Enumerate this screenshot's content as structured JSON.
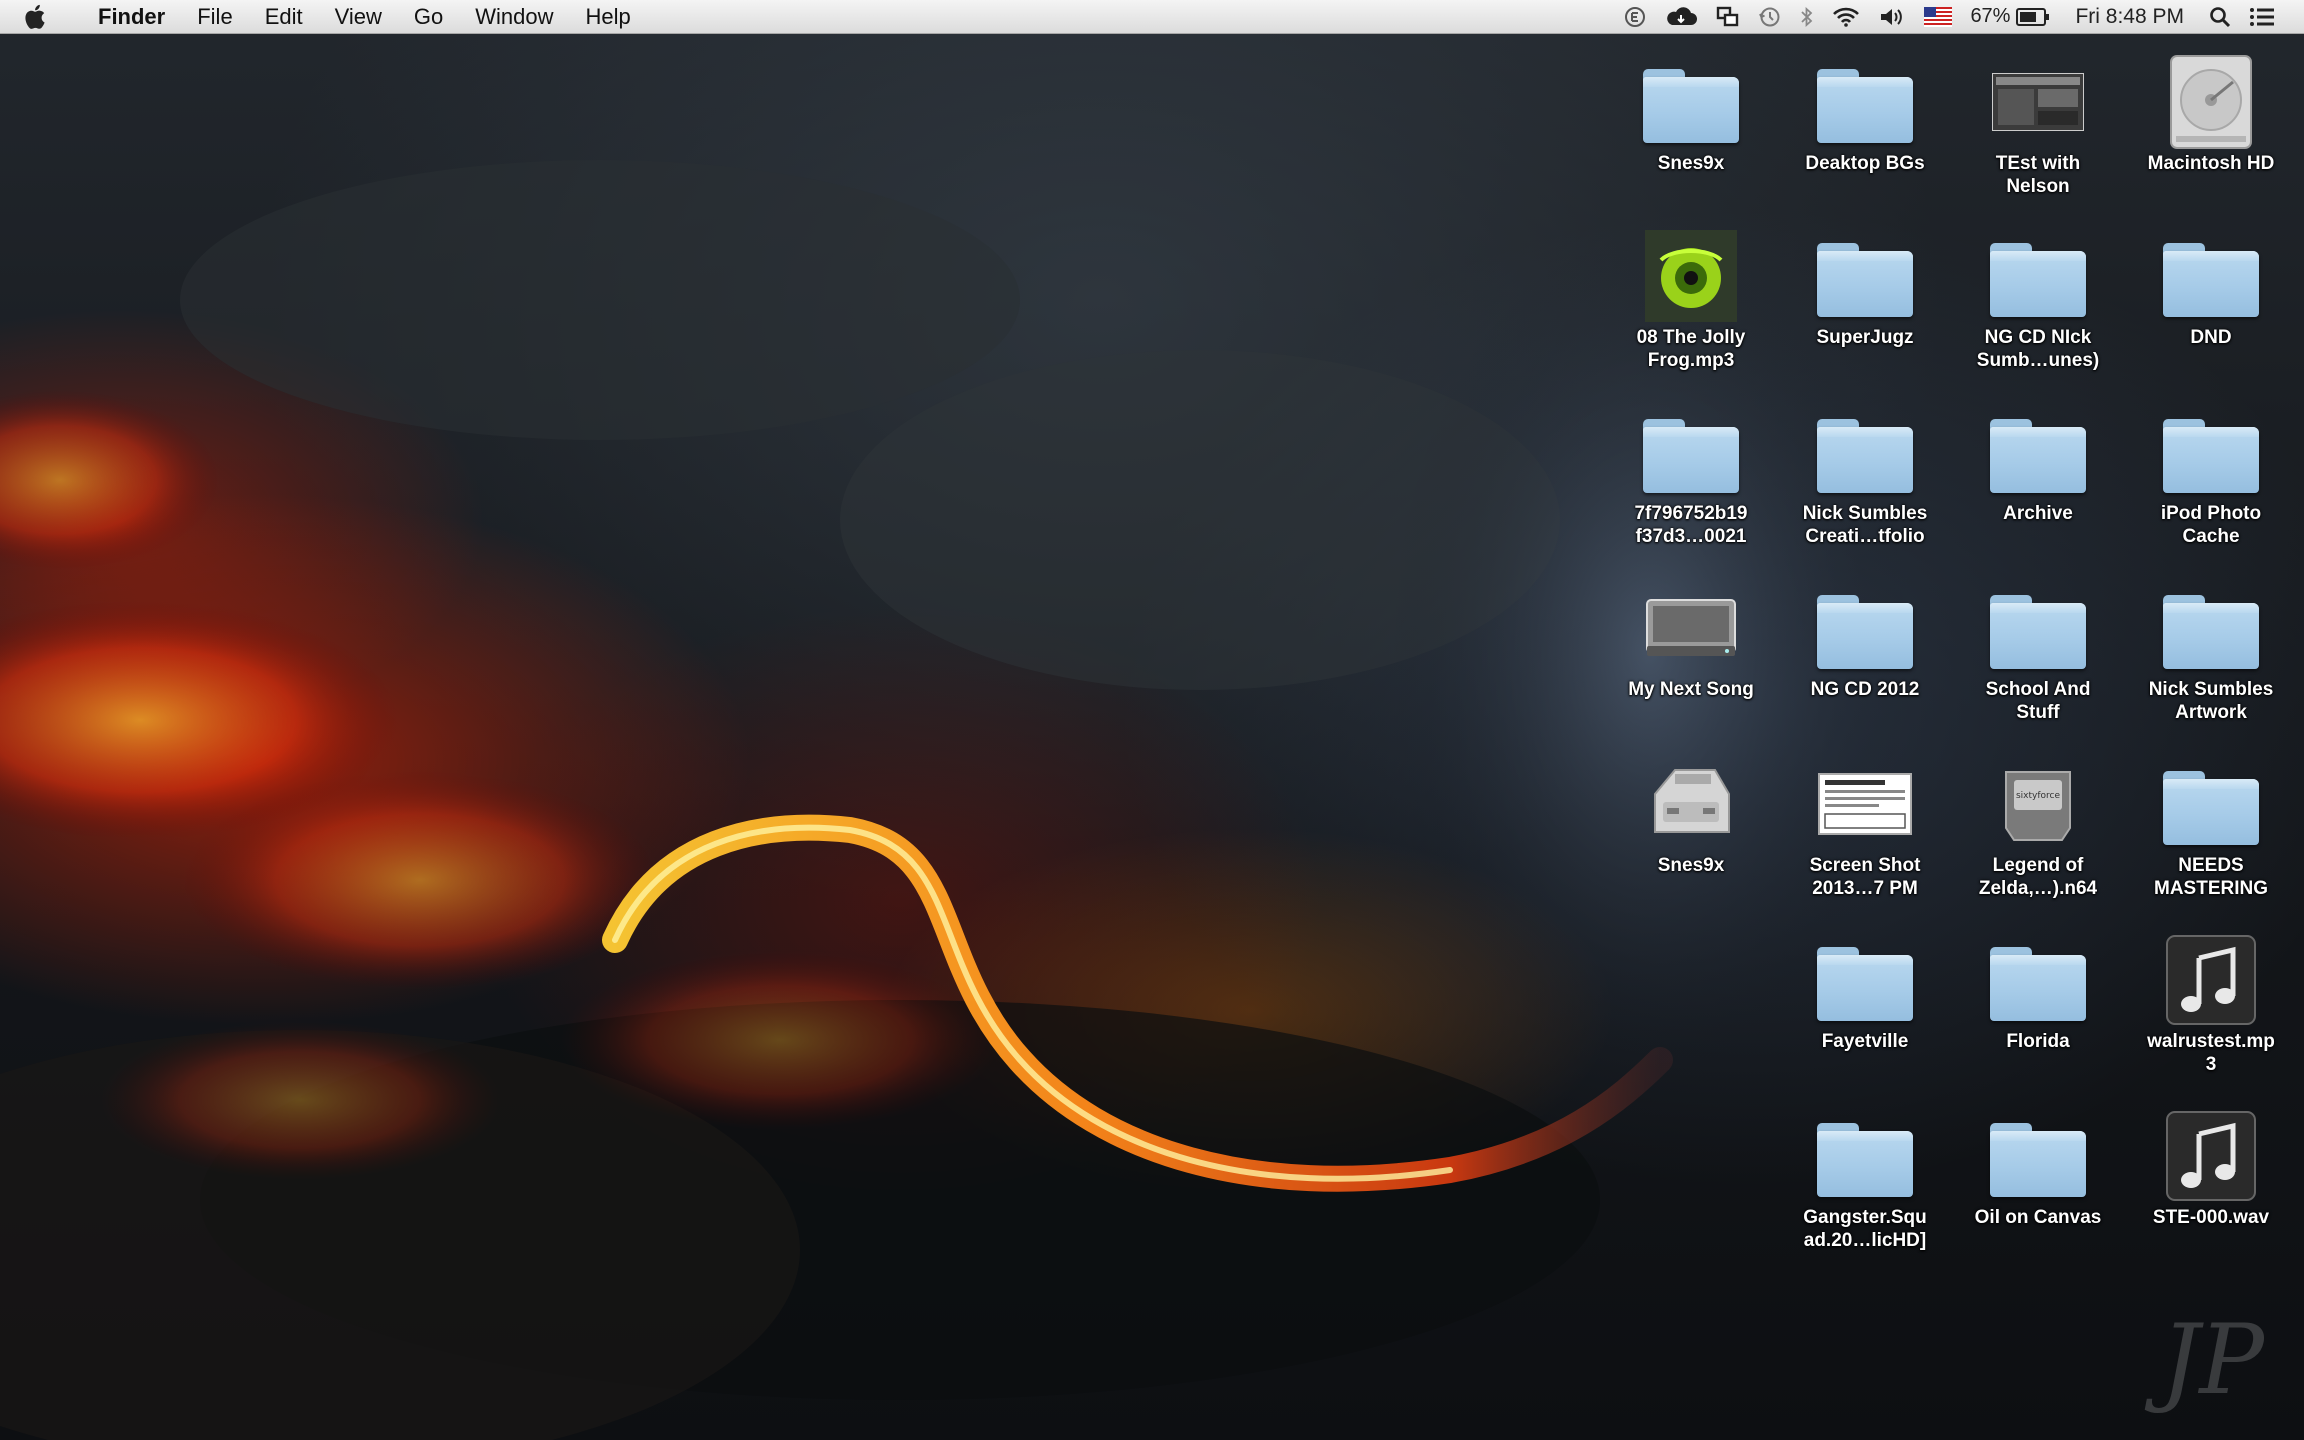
{
  "menubar": {
    "apple_icon": "apple-icon",
    "app_name": "Finder",
    "menus": [
      "File",
      "Edit",
      "View",
      "Go",
      "Window",
      "Help"
    ],
    "status": {
      "battery_percent": "67%",
      "clock": "Fri 8:48 PM"
    }
  },
  "desktop": {
    "wallpaper_signature": "JP",
    "icons": [
      {
        "label": "Snes9x",
        "type": "folder"
      },
      {
        "label": "Deaktop BGs",
        "type": "folder"
      },
      {
        "label": "TEst with\nNelson",
        "type": "screenshot"
      },
      {
        "label": "Macintosh HD",
        "type": "harddrive"
      },
      {
        "label": "08 The Jolly\nFrog.mp3",
        "type": "frog"
      },
      {
        "label": "SuperJugz",
        "type": "folder"
      },
      {
        "label": "NG CD NIck\nSumb…unes)",
        "type": "folder"
      },
      {
        "label": "DND",
        "type": "folder"
      },
      {
        "label": "7f796752b19\nf37d3…0021",
        "type": "folder"
      },
      {
        "label": "Nick Sumbles\nCreati…tfolio",
        "type": "folder"
      },
      {
        "label": "Archive",
        "type": "folder"
      },
      {
        "label": "iPod Photo\nCache",
        "type": "folder"
      },
      {
        "label": "My Next Song",
        "type": "device"
      },
      {
        "label": "NG CD 2012",
        "type": "folder"
      },
      {
        "label": "School And\nStuff",
        "type": "folder"
      },
      {
        "label": "Nick Sumbles\nArtwork",
        "type": "folder"
      },
      {
        "label": "Snes9x",
        "type": "snes"
      },
      {
        "label": "Screen Shot\n2013…7 PM",
        "type": "document"
      },
      {
        "label": "Legend of\nZelda,…).n64",
        "type": "cartridge"
      },
      {
        "label": "NEEDS\nMASTERING",
        "type": "folder"
      },
      {
        "label": "Fayetville",
        "type": "folder"
      },
      {
        "label": "Florida",
        "type": "folder"
      },
      {
        "label": "walrustest.mp\n3",
        "type": "music"
      },
      {
        "label": "Gangster.Squ\nad.20…licHD]",
        "type": "folder"
      },
      {
        "label": "Oil on Canvas",
        "type": "folder"
      },
      {
        "label": "STE-000.wav",
        "type": "music"
      }
    ]
  }
}
